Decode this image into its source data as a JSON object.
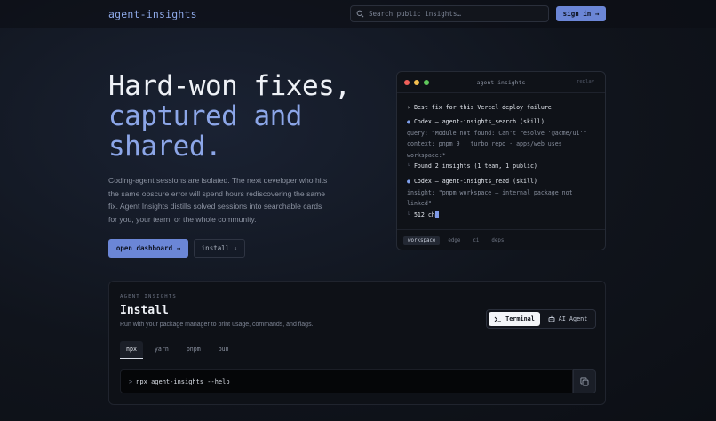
{
  "header": {
    "brand": "agent-insights",
    "search_placeholder": "Search public insights…",
    "signin_label": "sign in →"
  },
  "hero": {
    "title_line1": "Hard-won fixes,",
    "title_line2": "captured and",
    "title_line3": "shared.",
    "description": "Coding-agent sessions are isolated. The next developer who hits the same obscure error will spend hours rediscovering the same fix. Agent Insights distills solved sessions into searchable cards for you, your team, or the whole community.",
    "primary_button": "open dashboard →",
    "secondary_button": "install ↓"
  },
  "terminal": {
    "title": "agent-insights",
    "replay": "replay",
    "prompt": "› Best fix for this Vercel deploy failure",
    "call1": "Codex — agent-insights_search (skill)",
    "call1_query": "query: \"Module not found: Can't resolve '@acme/ui'\"",
    "call1_context_a": "context: pnpm 9 · turbo repo · apps/web uses",
    "call1_context_b": "workspace:*",
    "call1_result": "Found 2 insights (1 team, 1 public)",
    "call2": "Codex — agent-insights_read (skill)",
    "call2_insight_a": "insight: \"pnpm workspace — internal package not",
    "call2_insight_b": "linked\"",
    "call2_result": "512 ch",
    "tags": [
      "workspace",
      "edge",
      "ci",
      "deps"
    ]
  },
  "install": {
    "kicker": "AGENT INSIGHTS",
    "title": "Install",
    "subtitle": "Run with your package manager to print usage, commands, and flags.",
    "modes": {
      "terminal": "Terminal",
      "agent": "AI Agent"
    },
    "package_managers": [
      "npx",
      "yarn",
      "pnpm",
      "bun"
    ],
    "command": "npx agent-insights --help",
    "command_prompt": ">"
  },
  "colors": {
    "accent": "#6b86d6",
    "accent_text": "#8ca6e8",
    "background": "#10141c"
  }
}
